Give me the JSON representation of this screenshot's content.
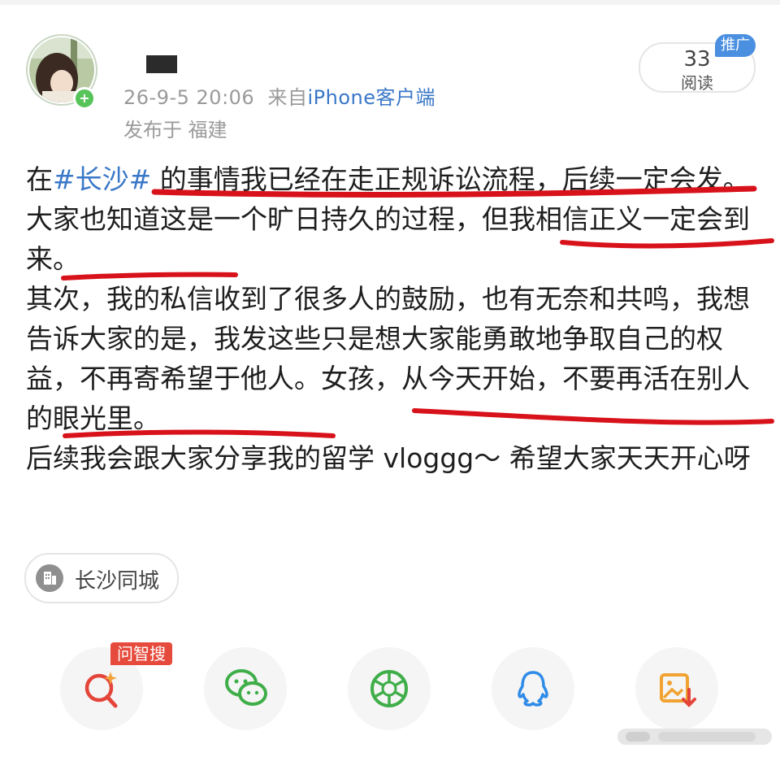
{
  "post": {
    "timestamp": "26-9-5 20:06",
    "source_prefix": "来自",
    "source": "iPhone客户端",
    "location_prefix": "发布于",
    "location": "福建",
    "read_count": "33",
    "read_label": "阅读",
    "promo_label": "推广",
    "text": {
      "p1_hashtag": "#长沙#",
      "p1_pre": "在",
      "p1_post": " 的事情我已经在走正规诉讼流程，后续一定会发。大家也知道这是一个旷日持久的过程，但我相信正义一定会到来。",
      "p2": "其次，我的私信收到了很多人的鼓励，也有无奈和共鸣，我想告诉大家的是，我发这些只是想大家能勇敢地争取自己的权益，不再寄希望于他人。女孩，从今天开始，不要再活在别人的眼光里。",
      "p3": "后续我会跟大家分享我的留学 vloggg～ 希望大家天天开心呀"
    },
    "location_chip": "长沙同城"
  },
  "share_bar": {
    "ai_tag": "问智搜",
    "buttons": [
      {
        "icon": "ai-search-icon"
      },
      {
        "icon": "wechat-icon"
      },
      {
        "icon": "moments-icon"
      },
      {
        "icon": "qq-icon"
      },
      {
        "icon": "save-image-icon"
      }
    ]
  },
  "colors": {
    "link": "#3a78c8",
    "meta": "#9a9a9a",
    "underline": "#d8121a",
    "promo": "#4a8fe0",
    "ai_tag": "#e64a3c"
  }
}
